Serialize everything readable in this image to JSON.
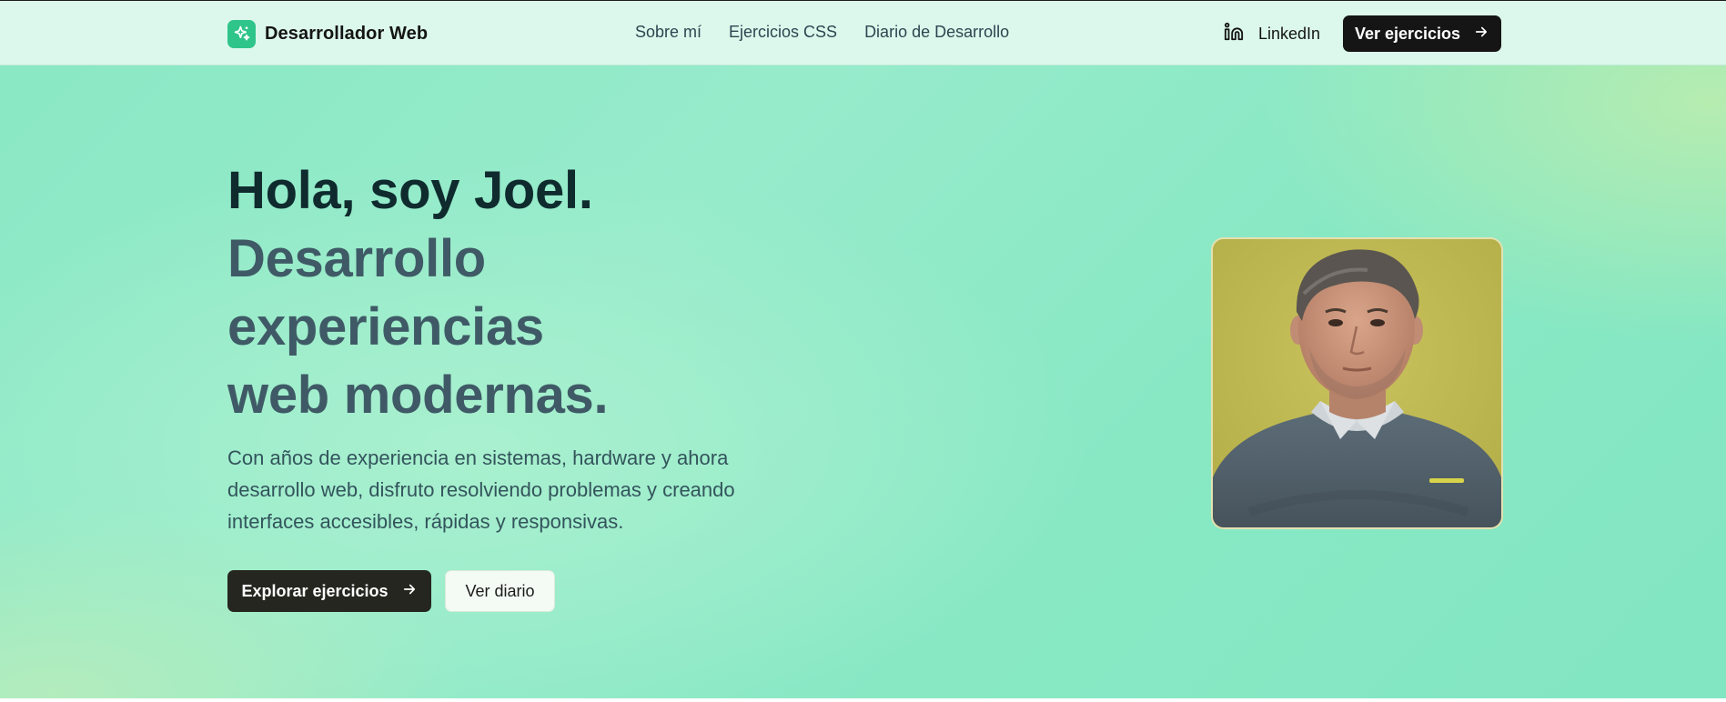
{
  "header": {
    "brand": {
      "name": "Desarrollador Web",
      "icon": "sparkles-icon",
      "accent": "#2fc58a"
    },
    "nav": [
      {
        "label": "Sobre mí"
      },
      {
        "label": "Ejercicios CSS"
      },
      {
        "label": "Diario de Desarrollo"
      }
    ],
    "linkedin": {
      "label": "LinkedIn",
      "icon": "linkedin-icon"
    },
    "cta": {
      "label": "Ver ejercicios",
      "icon": "arrow-right-icon"
    }
  },
  "hero": {
    "title_line1": "Hola, soy Joel.",
    "title_line2": "Desarrollo",
    "title_line3": "experiencias",
    "title_line4": "web modernas.",
    "intro_line1": "Con años de experiencia en sistemas, hardware y ahora",
    "intro_line2": "desarrollo web, disfruto resolviendo problemas y creando",
    "intro_line3": "interfaces accesibles, rápidas y responsivas.",
    "primary_button": {
      "label": "Explorar ejercicios",
      "icon": "arrow-right-icon"
    },
    "secondary_button": {
      "label": "Ver diario"
    },
    "portrait": {
      "alt": "Foto de Joel"
    }
  },
  "colors": {
    "hero_bg": "#8ae8c4",
    "header_bg": "#dcf8ec",
    "dark_button": "#151515",
    "title_dark": "#0f2b2e",
    "title_muted": "#3f5a66"
  }
}
